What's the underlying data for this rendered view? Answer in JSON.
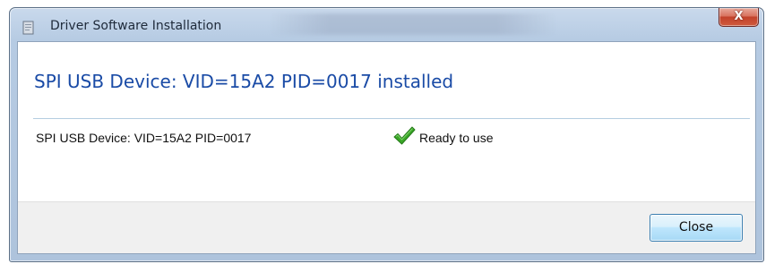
{
  "window": {
    "title": "Driver Software Installation",
    "close_glyph": "X"
  },
  "main": {
    "heading": "SPI USB Device: VID=15A2 PID=0017 installed",
    "devices": [
      {
        "name": "SPI USB Device: VID=15A2 PID=0017",
        "status": "Ready to use",
        "status_icon": "green-check-icon"
      }
    ]
  },
  "footer": {
    "close_label": "Close"
  },
  "colors": {
    "heading": "#1a4ba6",
    "check": "#3aa627",
    "frame": "#b6cbe3",
    "footer_bg": "#f0f0f0"
  }
}
